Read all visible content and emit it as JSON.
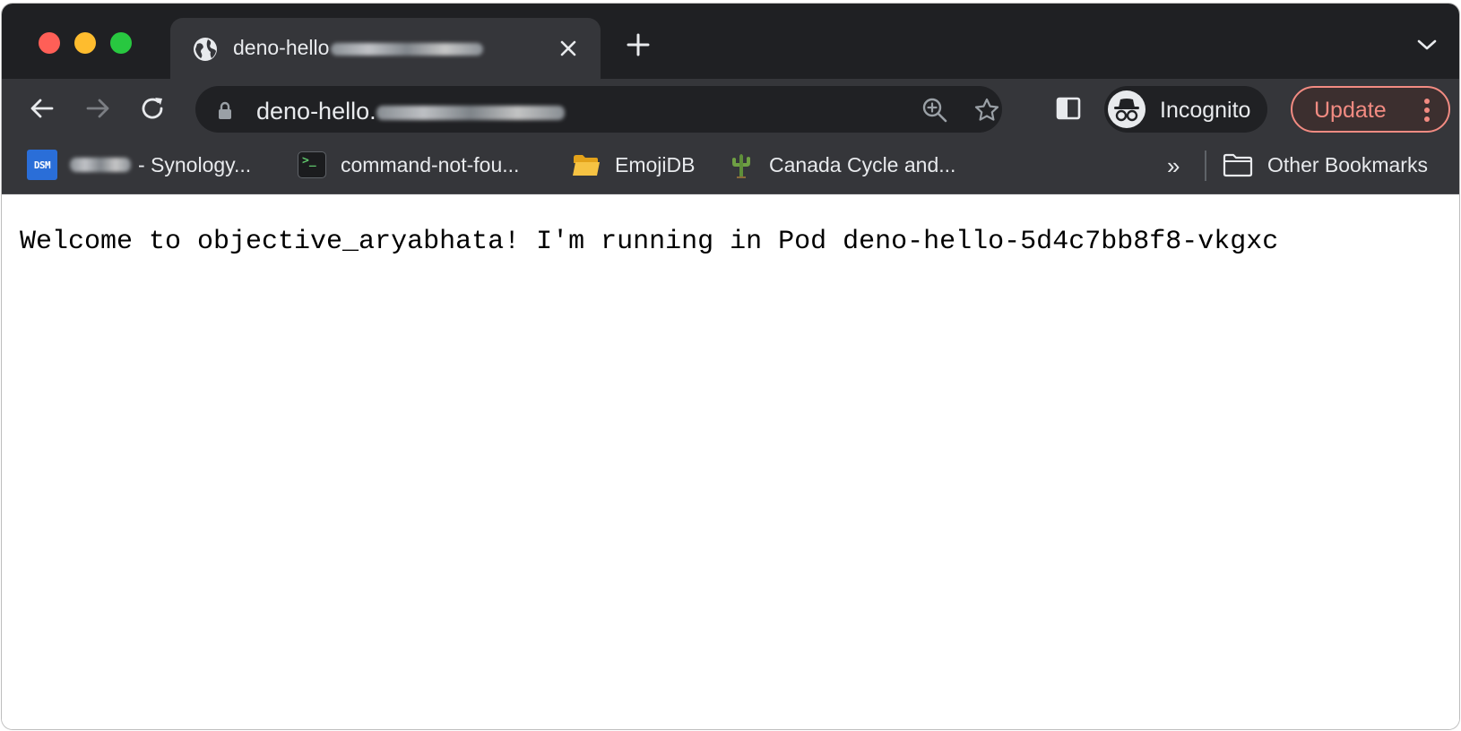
{
  "browser": {
    "tab": {
      "title_prefix": "deno-hello"
    },
    "address_bar": {
      "url_prefix": "deno-hello."
    },
    "profile": {
      "label": "Incognito"
    },
    "update_button": {
      "label": "Update"
    },
    "bookmarks": [
      {
        "icon": "dsm-icon",
        "icon_text": "DSM",
        "label": " - Synology..."
      },
      {
        "icon": "terminal-icon",
        "icon_text": ">_",
        "label": "command-not-fou..."
      },
      {
        "icon": "folder-icon",
        "label": "EmojiDB"
      },
      {
        "icon": "cactus-icon",
        "label": "Canada Cycle and..."
      }
    ],
    "overflow": "»",
    "other_bookmarks": {
      "icon": "folder-icon",
      "label": "Other Bookmarks"
    }
  },
  "page": {
    "text": "Welcome to objective_aryabhata! I'm running in Pod deno-hello-5d4c7bb8f8-vkgxc"
  },
  "colors": {
    "tabstrip": "#1f2023",
    "toolbar": "#35363a",
    "update_accent": "#f28b82"
  }
}
